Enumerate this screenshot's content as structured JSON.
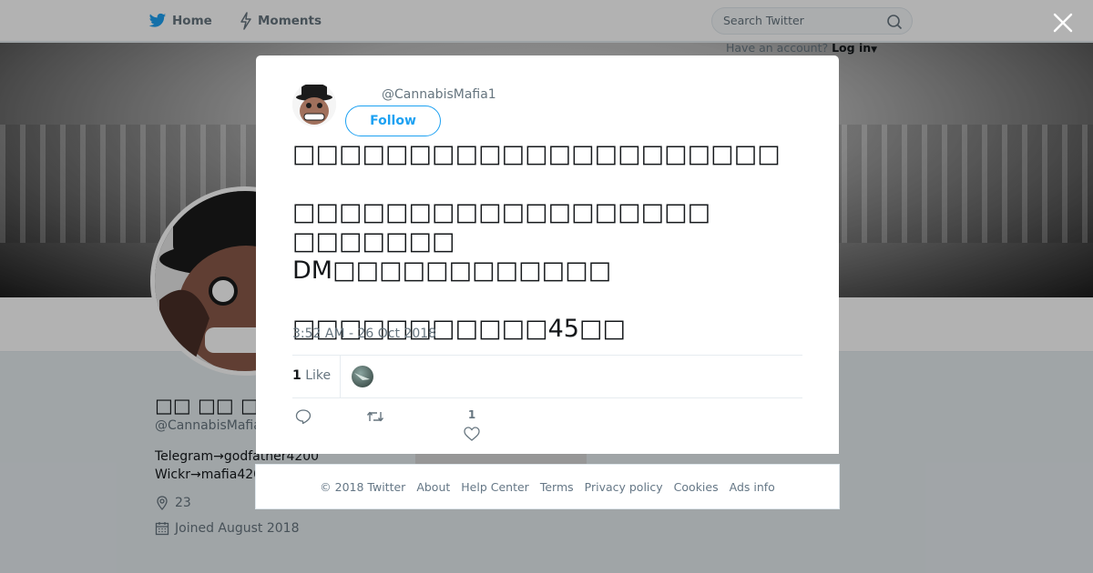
{
  "nav": {
    "home": "Home",
    "moments": "Moments",
    "search_placeholder": "Search Twitter",
    "have_account": "Have an account?",
    "login": "Log in"
  },
  "profile": {
    "name": "□□ □□ □□",
    "handle": "@CannabisMafia1",
    "bio_line1": "Telegram→godfather4200",
    "bio_line2": "Wickr→mafia4200",
    "location": "23",
    "joined": "Joined August 2018",
    "photos_label": "Ads info"
  },
  "tweet": {
    "handle": "@CannabisMafia1",
    "follow_label": "Follow",
    "text": "□□□□□□□□□□□□□□□□□□□□□\n\n□□□□□□□□□□□□□□□□□□ □□□□□□□\nDM□□□□□□□□□□□□\n\n□□□□□□□□□□□45□□",
    "timestamp": "3:52 AM - 26 Oct 2018",
    "like_count": "1",
    "like_label": "Like",
    "action_like_count": "1"
  },
  "footer": {
    "copyright": "© 2018 Twitter",
    "links": [
      "About",
      "Help Center",
      "Terms",
      "Privacy policy",
      "Cookies",
      "Ads info"
    ]
  },
  "colors": {
    "accent": "#1da1f2",
    "muted": "#66757f",
    "overlay": "rgba(0,0,0,0.3)"
  }
}
